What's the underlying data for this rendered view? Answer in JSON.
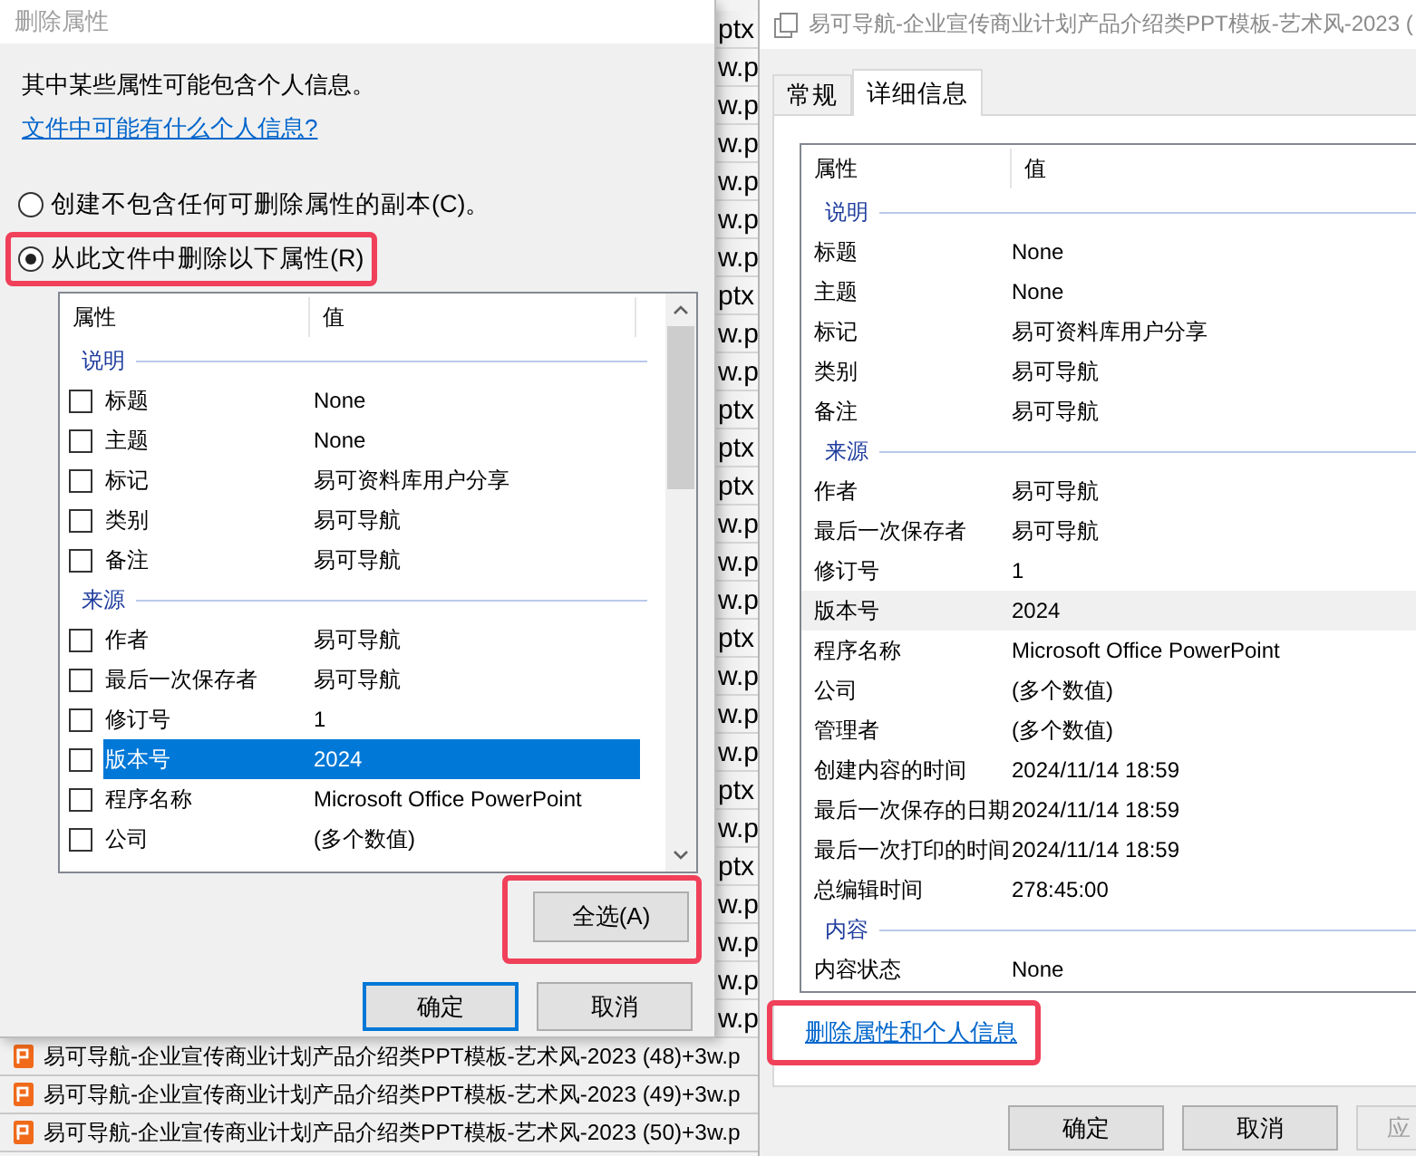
{
  "explorer": {
    "strip": [
      {
        "text": "ptx"
      },
      {
        "text": "w.p"
      },
      {
        "text": "w.p"
      },
      {
        "text": "w.p"
      },
      {
        "text": "w.p"
      },
      {
        "text": "w.p"
      },
      {
        "text": "w.p"
      },
      {
        "text": "ptx"
      },
      {
        "text": "w.p"
      },
      {
        "text": "w.p"
      },
      {
        "text": "ptx"
      },
      {
        "text": "ptx"
      },
      {
        "text": "ptx"
      },
      {
        "text": "w.p"
      },
      {
        "text": "w.p"
      },
      {
        "text": "w.p"
      },
      {
        "text": "ptx"
      },
      {
        "text": "w.p"
      },
      {
        "text": "w.p"
      },
      {
        "text": "w.p"
      },
      {
        "text": "ptx"
      },
      {
        "text": "w.p"
      },
      {
        "text": "ptx"
      },
      {
        "text": "w.p"
      },
      {
        "text": "w.p"
      },
      {
        "text": "w.p"
      },
      {
        "text": "w.p"
      }
    ],
    "files": [
      {
        "name": "易可导航-企业宣传商业计划产品介绍类PPT模板-艺术风-2023 (48)+3w.p"
      },
      {
        "name": "易可导航-企业宣传商业计划产品介绍类PPT模板-艺术风-2023 (49)+3w.p"
      },
      {
        "name": "易可导航-企业宣传商业计划产品介绍类PPT模板-艺术风-2023 (50)+3w.p"
      }
    ]
  },
  "remove_dialog": {
    "title": "删除属性",
    "intro": "其中某些属性可能包含个人信息。",
    "help_link": "文件中可能有什么个人信息?",
    "options": [
      {
        "label": "创建不包含任何可删除属性的副本(C)。",
        "selected": false,
        "highlighted": false
      },
      {
        "label": "从此文件中删除以下属性(R)",
        "selected": true,
        "highlighted": true
      }
    ],
    "table": {
      "columns": [
        "属性",
        "值"
      ],
      "groups": [
        {
          "name": "说明",
          "rows": [
            {
              "property": "标题",
              "value": "None",
              "checked": false,
              "selected": false
            },
            {
              "property": "主题",
              "value": "None",
              "checked": false,
              "selected": false
            },
            {
              "property": "标记",
              "value": "易可资料库用户分享",
              "checked": false,
              "selected": false
            },
            {
              "property": "类别",
              "value": "易可导航",
              "checked": false,
              "selected": false
            },
            {
              "property": "备注",
              "value": "易可导航",
              "checked": false,
              "selected": false
            }
          ]
        },
        {
          "name": "来源",
          "rows": [
            {
              "property": "作者",
              "value": "易可导航",
              "checked": false,
              "selected": false
            },
            {
              "property": "最后一次保存者",
              "value": "易可导航",
              "checked": false,
              "selected": false
            },
            {
              "property": "修订号",
              "value": "1",
              "checked": false,
              "selected": false
            },
            {
              "property": "版本号",
              "value": "2024",
              "checked": false,
              "selected": true
            },
            {
              "property": "程序名称",
              "value": "Microsoft Office PowerPoint",
              "checked": false,
              "selected": false
            },
            {
              "property": "公司",
              "value": "(多个数值)",
              "checked": false,
              "selected": false
            }
          ]
        }
      ]
    },
    "select_all_button": {
      "label": "全选(A)",
      "highlighted": true
    },
    "buttons": [
      {
        "label": "确定",
        "default": true
      },
      {
        "label": "取消",
        "default": false
      }
    ]
  },
  "properties_window": {
    "title": "易可导航-企业宣传商业计划产品介绍类PPT模板-艺术风-2023 (",
    "tabs": [
      {
        "label": "常规",
        "selected": false
      },
      {
        "label": "详细信息",
        "selected": true
      }
    ],
    "table": {
      "columns": [
        "属性",
        "值"
      ],
      "groups": [
        {
          "name": "说明",
          "rows": [
            {
              "property": "标题",
              "value": "None",
              "selected": false
            },
            {
              "property": "主题",
              "value": "None",
              "selected": false
            },
            {
              "property": "标记",
              "value": "易可资料库用户分享",
              "selected": false
            },
            {
              "property": "类别",
              "value": "易可导航",
              "selected": false
            },
            {
              "property": "备注",
              "value": "易可导航",
              "selected": false
            }
          ]
        },
        {
          "name": "来源",
          "rows": [
            {
              "property": "作者",
              "value": "易可导航",
              "selected": false
            },
            {
              "property": "最后一次保存者",
              "value": "易可导航",
              "selected": false
            },
            {
              "property": "修订号",
              "value": "1",
              "selected": false
            },
            {
              "property": "版本号",
              "value": "2024",
              "selected": true
            },
            {
              "property": "程序名称",
              "value": "Microsoft Office PowerPoint",
              "selected": false
            },
            {
              "property": "公司",
              "value": "(多个数值)",
              "selected": false
            },
            {
              "property": "管理者",
              "value": "(多个数值)",
              "selected": false
            },
            {
              "property": "创建内容的时间",
              "value": "2024/11/14 18:59",
              "selected": false
            },
            {
              "property": "最后一次保存的日期",
              "value": "2024/11/14 18:59",
              "selected": false
            },
            {
              "property": "最后一次打印的时间",
              "value": "2024/11/14 18:59",
              "selected": false
            },
            {
              "property": "总编辑时间",
              "value": "278:45:00",
              "selected": false
            }
          ]
        },
        {
          "name": "内容",
          "rows": [
            {
              "property": "内容状态",
              "value": "None",
              "selected": false
            }
          ]
        }
      ]
    },
    "remove_link": {
      "text": "删除属性和个人信息",
      "highlighted": true
    },
    "buttons": [
      {
        "label": "确定",
        "disabled": false
      },
      {
        "label": "取消",
        "disabled": false
      },
      {
        "label": "应",
        "disabled": true
      }
    ]
  }
}
